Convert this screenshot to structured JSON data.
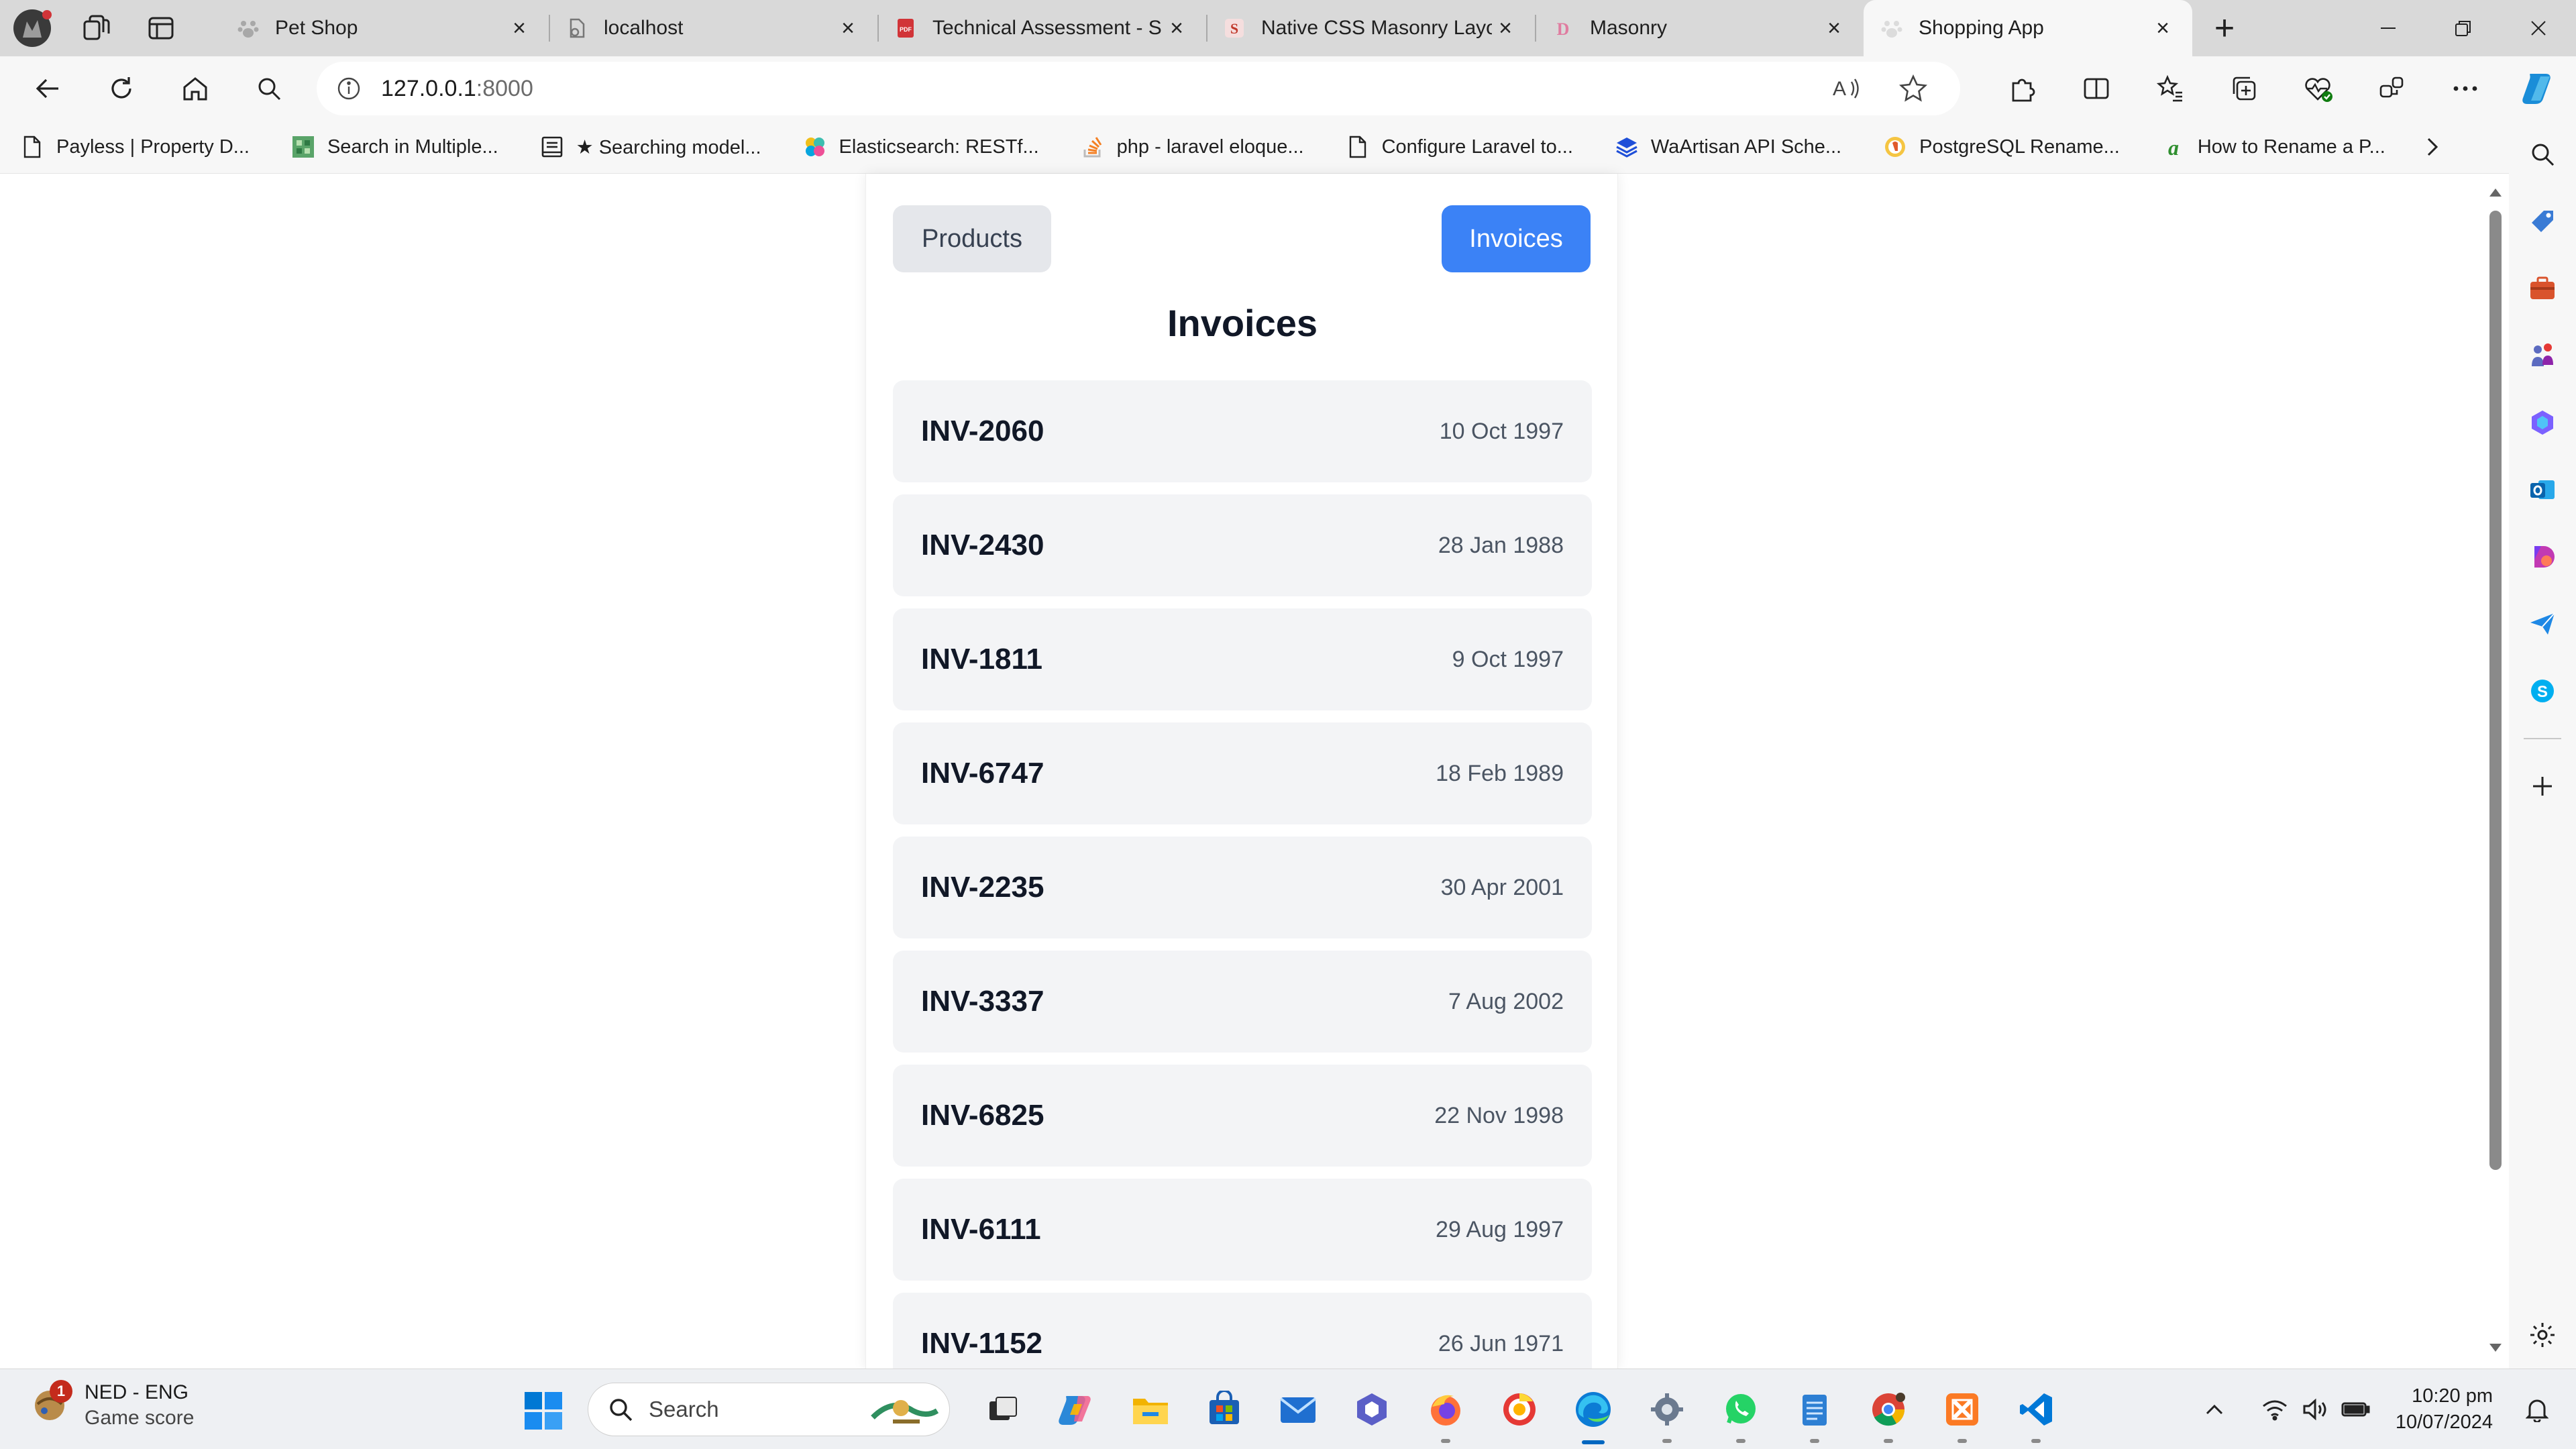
{
  "browser": {
    "tabs": [
      {
        "title": "Pet Shop",
        "icon": "paw-icon"
      },
      {
        "title": "localhost",
        "icon": "page-icon"
      },
      {
        "title": "Technical Assessment - S",
        "icon": "pdf-icon"
      },
      {
        "title": "Native CSS Masonry Layo",
        "icon": "s-logo-icon"
      },
      {
        "title": "Masonry",
        "icon": "d-logo-icon"
      },
      {
        "title": "Shopping App",
        "icon": "paw-icon"
      }
    ],
    "active_tab": 5,
    "address": {
      "host": "127.0.0.1",
      "port": ":8000"
    },
    "bookmarks": [
      {
        "label": "Payless | Property D...",
        "icon": "page-icon"
      },
      {
        "label": "Search in Multiple...",
        "icon": "tiles-icon"
      },
      {
        "label": "★ Searching model...",
        "icon": "book-icon"
      },
      {
        "label": "Elasticsearch: RESTf...",
        "icon": "elastic-icon"
      },
      {
        "label": "php - laravel eloque...",
        "icon": "stackoverflow-icon"
      },
      {
        "label": "Configure Laravel to...",
        "icon": "page-icon"
      },
      {
        "label": "WaArtisan API Sche...",
        "icon": "layers-icon"
      },
      {
        "label": "PostgreSQL Rename...",
        "icon": "postgres-icon"
      },
      {
        "label": "How to Rename a P...",
        "icon": "a-logo-icon"
      }
    ]
  },
  "app": {
    "nav": {
      "products": "Products",
      "invoices": "Invoices"
    },
    "title": "Invoices",
    "invoices": [
      {
        "number": "INV-2060",
        "date": "10 Oct 1997"
      },
      {
        "number": "INV-2430",
        "date": "28 Jan 1988"
      },
      {
        "number": "INV-1811",
        "date": "9 Oct 1997"
      },
      {
        "number": "INV-6747",
        "date": "18 Feb 1989"
      },
      {
        "number": "INV-2235",
        "date": "30 Apr 2001"
      },
      {
        "number": "INV-3337",
        "date": "7 Aug 2002"
      },
      {
        "number": "INV-6825",
        "date": "22 Nov 1998"
      },
      {
        "number": "INV-6111",
        "date": "29 Aug 1997"
      },
      {
        "number": "INV-1152",
        "date": "26 Jun 1971"
      }
    ],
    "colors": {
      "primary": "#3b82f6",
      "secondary": "#e5e7eb",
      "row": "#f3f4f6"
    }
  },
  "taskbar": {
    "weather": {
      "badge": "1",
      "line1": "NED - ENG",
      "line2": "Game score"
    },
    "search_placeholder": "Search",
    "clock": {
      "time": "10:20 pm",
      "date": "10/07/2024"
    }
  }
}
